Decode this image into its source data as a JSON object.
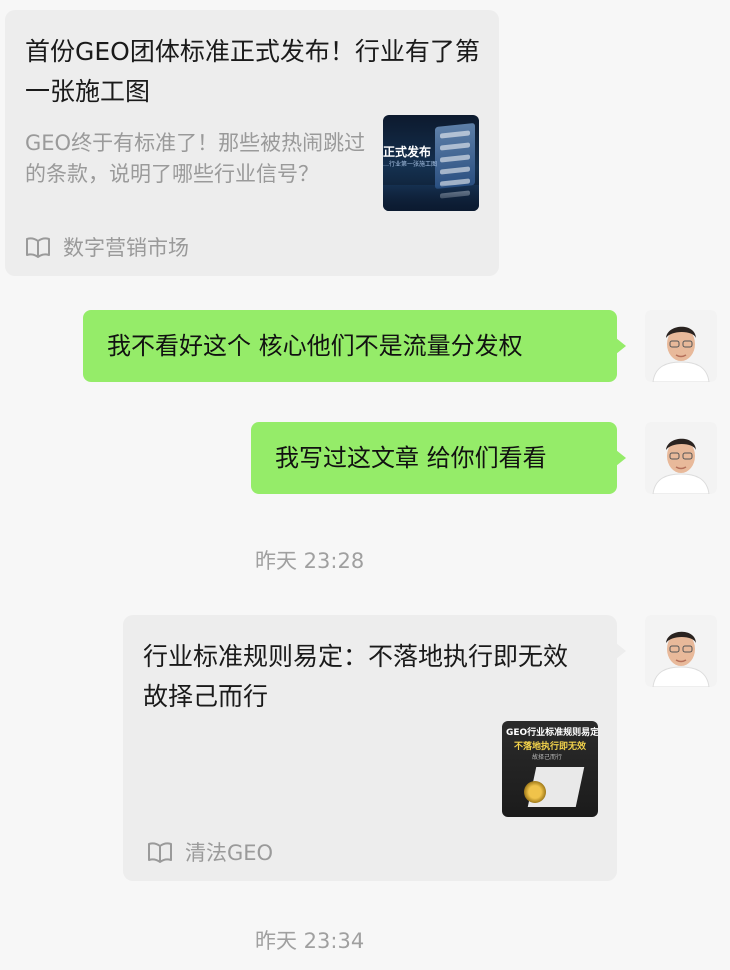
{
  "messages": {
    "shared_article_in": {
      "title": "首份GEO团体标准正式发布！行业有了第一张施工图",
      "description": "GEO终于有标准了！那些被热闹跳过的条款，说明了哪些行业信号？",
      "thumbnail_text": "正式发布",
      "thumbnail_subtext": "…行业第一张施工图",
      "source": "数字营销市场",
      "source_icon": "book-icon"
    },
    "text_1": "我不看好这个 核心他们不是流量分发权",
    "text_2": "我写过这文章 给你们看看",
    "timestamp_1": "昨天 23:28",
    "shared_article_out": {
      "title": "行业标准规则易定：不落地执行即无效 故择己而行",
      "thumbnail_line1": "GEO行业标准规则易定",
      "thumbnail_line2": "不落地执行即无效",
      "thumbnail_line3": "故择己而行",
      "source": "清法GEO",
      "source_icon": "book-icon"
    },
    "timestamp_2": "昨天 23:34"
  },
  "colors": {
    "background": "#f7f7f7",
    "sent_bubble": "#95ec69",
    "card": "#ededed",
    "muted_text": "#9a9a9a"
  }
}
